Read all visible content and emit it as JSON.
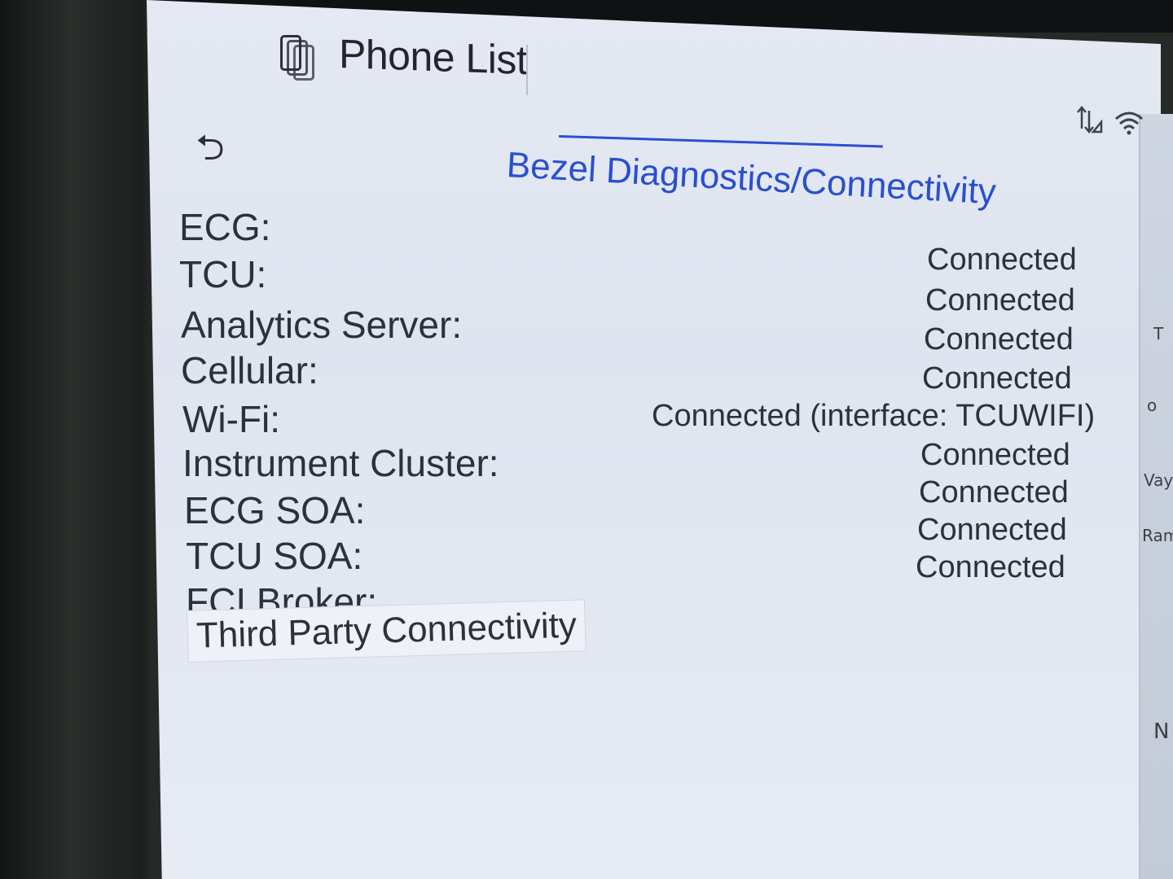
{
  "header": {
    "title": "Phone List"
  },
  "status_bar": {
    "data_icon": "signal-arrows-icon",
    "wifi_icon": "wifi-icon"
  },
  "nav": {
    "back_icon": "back-arrow-icon",
    "back_glyph": "⮌"
  },
  "page": {
    "title": "Bezel Diagnostics/Connectivity"
  },
  "diagnostics": {
    "rows": [
      {
        "label": "ECG:",
        "value": "Connected"
      },
      {
        "label": "TCU:",
        "value": "Connected"
      },
      {
        "label": "Analytics Server:",
        "value": "Connected"
      },
      {
        "label": "Cellular:",
        "value": "Connected"
      },
      {
        "label": "Wi-Fi:",
        "value": "Connected (interface: TCUWIFI)"
      },
      {
        "label": "Instrument Cluster:",
        "value": "Connected"
      },
      {
        "label": "ECG SOA:",
        "value": "Connected"
      },
      {
        "label": "TCU SOA:",
        "value": "Connected"
      },
      {
        "label": "FCI Broker:",
        "value": "Connected"
      }
    ],
    "third_party_button": "Third Party Connectivity"
  },
  "side_panel": {
    "fragments": [
      "T",
      "o",
      "Vay",
      "Ram",
      "N"
    ]
  },
  "colors": {
    "accent": "#2a4fd0",
    "text": "#2d3138",
    "screen_bg": "#e2e7f1"
  }
}
